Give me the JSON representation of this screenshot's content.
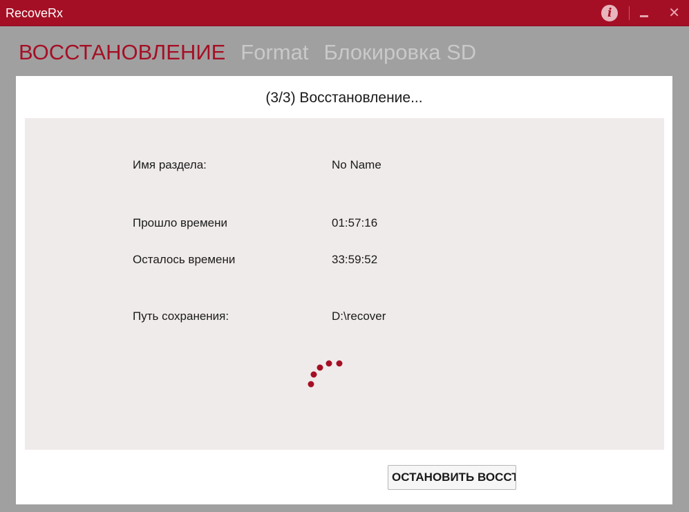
{
  "window": {
    "title": "RecoveRx",
    "accent_color": "#a50f25",
    "controls": {
      "info_icon": "info-icon",
      "minimize_icon": "minimize-icon",
      "close_symbol": "✕"
    }
  },
  "tabs": [
    {
      "label": "ВОССТАНОВЛЕНИЕ",
      "active": true
    },
    {
      "label": "Format",
      "active": false
    },
    {
      "label": "Блокировка SD",
      "active": false
    }
  ],
  "main": {
    "title": "(3/3) Восстановление...",
    "rows": [
      {
        "label": "Имя раздела:",
        "value": "No Name"
      },
      {
        "label": "Прошло времени",
        "value": "01:57:16"
      },
      {
        "label": "Осталось времени",
        "value": "33:59:52"
      },
      {
        "label": "Путь сохранения:",
        "value": "D:\\recover"
      }
    ],
    "spinner_icon": "loading-spinner-icon",
    "stop_button_label": "ОСТАНОВИТЬ ВОССТАНОВЛЕНИЕ"
  }
}
